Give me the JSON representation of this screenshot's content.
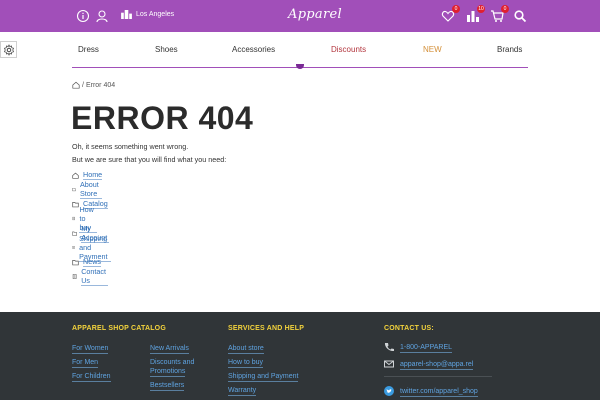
{
  "header": {
    "city": "Los Angeles",
    "logo": "Apparel",
    "wishlist_count": "0",
    "compare_count": "10",
    "cart_count": "0"
  },
  "nav": {
    "items": [
      "Dress",
      "Shoes",
      "Accessories",
      "Discounts",
      "NEW",
      "Brands"
    ]
  },
  "breadcrumb": {
    "current": "Error 404"
  },
  "content": {
    "title": "ERROR 404",
    "line1": "Oh, it seems something went wrong.",
    "line2": "But we are sure that you will find what you need:",
    "links": [
      "Home",
      "About Store",
      "Catalog",
      "How to buy",
      "My Account",
      "Shipping and Payment",
      "News",
      "Contact Us"
    ]
  },
  "footer": {
    "catalog_heading": "APPAREL SHOP CATALOG",
    "catalog_col1": [
      "For Women",
      "For Men",
      "For Children"
    ],
    "catalog_col2": [
      "New Arrivals",
      "Discounts and",
      "Promotions",
      "Bestsellers"
    ],
    "services_heading": "SERVICES AND HELP",
    "services": [
      "About store",
      "How to buy",
      "Shipping and Payment",
      "Warranty"
    ],
    "contact_heading": "CONTACT US:",
    "phone": "1-800-APPAREL",
    "email": "apparel-shop@appa.rel",
    "twitter": "twitter.com/apparel_shop"
  },
  "colors": {
    "topbar": "#a14fb9",
    "discounts": "#b3363e",
    "new": "#d4903a",
    "link": "#2f6fb7",
    "footer_bg": "#303538",
    "footer_heading": "#f3d33c"
  },
  "icons": [
    "info-icon",
    "user-icon",
    "city-icon",
    "heart-icon",
    "compare-icon",
    "cart-icon",
    "search-icon",
    "gear-icon",
    "home-icon",
    "folder-icon",
    "doc-icon",
    "phone-icon",
    "mail-icon",
    "twitter-icon"
  ]
}
